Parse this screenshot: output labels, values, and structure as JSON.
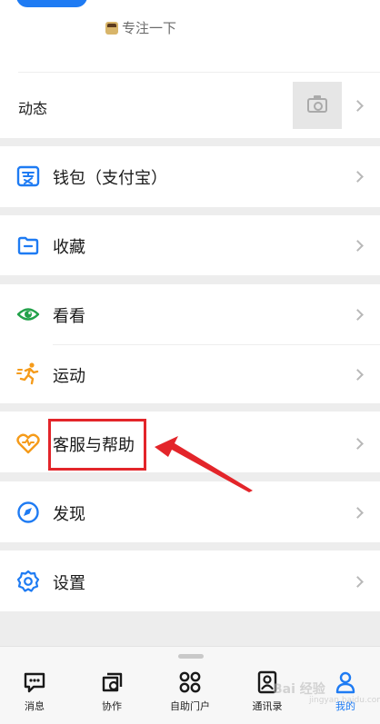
{
  "profile": {
    "status_text": "专注一下",
    "status_icon": "working-emoji-icon"
  },
  "moments": {
    "label": "动态",
    "thumbnail_icon": "camera-icon"
  },
  "menu": [
    {
      "label": "钱包（支付宝）",
      "icon": "wallet-icon",
      "color": "#1e7bf3"
    },
    {
      "label": "收藏",
      "icon": "folder-icon",
      "color": "#1e7bf3"
    },
    {
      "label": "看看",
      "icon": "eye-icon",
      "color": "#22a14a"
    },
    {
      "label": "运动",
      "icon": "running-icon",
      "color": "#f59b1a"
    },
    {
      "label": "客服与帮助",
      "icon": "heart-icon",
      "color": "#f59b1a"
    },
    {
      "label": "发现",
      "icon": "compass-icon",
      "color": "#1e7bf3"
    },
    {
      "label": "设置",
      "icon": "gear-icon",
      "color": "#1e7bf3"
    }
  ],
  "tabs": [
    {
      "label": "消息",
      "icon": "message-icon"
    },
    {
      "label": "协作",
      "icon": "collaboration-icon"
    },
    {
      "label": "自助门户",
      "icon": "portal-grid-icon"
    },
    {
      "label": "通讯录",
      "icon": "contacts-icon"
    },
    {
      "label": "我的",
      "icon": "profile-icon",
      "active": true
    }
  ],
  "annotation": {
    "highlight_color": "#e3252a"
  },
  "watermark": {
    "main": "Bai 经验",
    "sub": "jingyan.baidu.com"
  },
  "colors": {
    "accent": "#1e7bf3",
    "background": "#ededed"
  }
}
